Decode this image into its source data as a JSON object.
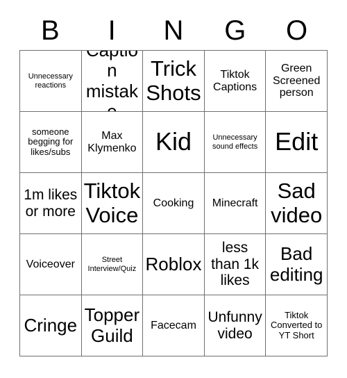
{
  "card": {
    "header_letters": [
      "B",
      "I",
      "N",
      "G",
      "O"
    ],
    "rows": [
      [
        {
          "text": "Unnecessary reactions",
          "size": "fs-xs"
        },
        {
          "text": "Caption mistake",
          "size": "fs-xl"
        },
        {
          "text": "Trick Shots",
          "size": "fs-xxl"
        },
        {
          "text": "Tiktok Captions",
          "size": "fs-m"
        },
        {
          "text": "Green Screened person",
          "size": "fs-m"
        }
      ],
      [
        {
          "text": "someone begging for likes/subs",
          "size": "fs-s"
        },
        {
          "text": "Max Klymenko",
          "size": "fs-m"
        },
        {
          "text": "Kid",
          "size": "fs-huge"
        },
        {
          "text": "Unnecessary sound effects",
          "size": "fs-xs"
        },
        {
          "text": "Edit",
          "size": "fs-huge"
        }
      ],
      [
        {
          "text": "1m likes or more",
          "size": "fs-l"
        },
        {
          "text": "Tiktok Voice",
          "size": "fs-xxl"
        },
        {
          "text": "Cooking",
          "size": "fs-m"
        },
        {
          "text": "Minecraft",
          "size": "fs-m"
        },
        {
          "text": "Sad video",
          "size": "fs-xxl"
        }
      ],
      [
        {
          "text": "Voiceover",
          "size": "fs-m"
        },
        {
          "text": "Street Interview/Quiz",
          "size": "fs-xs"
        },
        {
          "text": "Roblox",
          "size": "fs-xl"
        },
        {
          "text": "less than 1k likes",
          "size": "fs-l"
        },
        {
          "text": "Bad editing",
          "size": "fs-xl"
        }
      ],
      [
        {
          "text": "Cringe",
          "size": "fs-xl"
        },
        {
          "text": "Topper Guild",
          "size": "fs-xl"
        },
        {
          "text": "Facecam",
          "size": "fs-m"
        },
        {
          "text": "Unfunny video",
          "size": "fs-l"
        },
        {
          "text": "Tiktok Converted to YT Short",
          "size": "fs-s"
        }
      ]
    ]
  },
  "colors": {
    "background": "#ffffff",
    "text": "#000000",
    "grid_line": "#6f6f6f"
  }
}
